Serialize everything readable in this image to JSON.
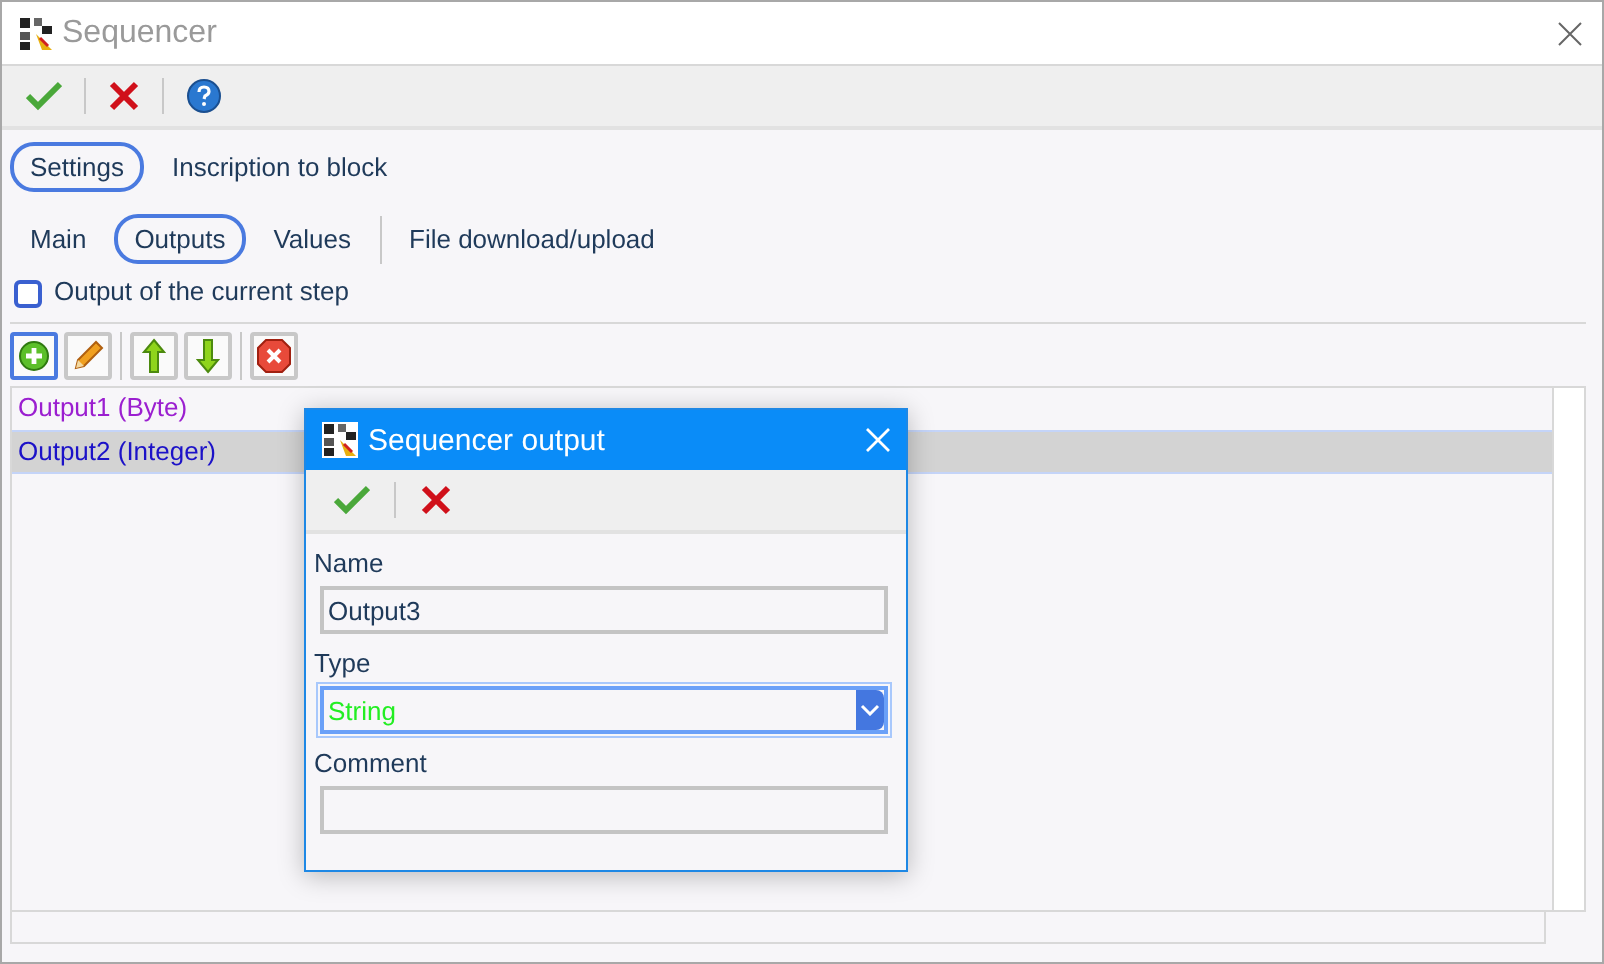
{
  "window": {
    "title": "Sequencer"
  },
  "toolbar": [
    {
      "kind": "ok"
    },
    {
      "kind": "cancel"
    },
    {
      "kind": "help"
    }
  ],
  "tabs": [
    {
      "label": "Settings",
      "selected": true
    },
    {
      "label": "Inscription to block",
      "selected": false
    }
  ],
  "subtabs": [
    {
      "label": "Main",
      "selected": false
    },
    {
      "label": "Outputs",
      "selected": true
    },
    {
      "label": "Values",
      "selected": false
    },
    {
      "label": "File download/upload",
      "selected": false,
      "separated": true
    }
  ],
  "checkbox": {
    "label": "Output of the current step",
    "checked": false
  },
  "list_toolbar": [
    {
      "kind": "add",
      "focused": true
    },
    {
      "kind": "edit",
      "focused": false
    },
    {
      "kind": "up",
      "focused": false
    },
    {
      "kind": "down",
      "focused": false
    },
    {
      "kind": "delete",
      "focused": false
    }
  ],
  "list": {
    "items": [
      {
        "label": "Output1 (Byte)",
        "color": "#9b1fd0",
        "selected": false
      },
      {
        "label": "Output2 (Integer)",
        "color": "#1c12c8",
        "selected": true
      }
    ]
  },
  "dialog": {
    "title": "Sequencer output",
    "toolbar": [
      {
        "kind": "ok"
      },
      {
        "kind": "cancel"
      }
    ],
    "fields": [
      {
        "label": "Name",
        "kind": "text",
        "value": "Output3",
        "focused": false
      },
      {
        "label": "Type",
        "kind": "select",
        "value": "String",
        "color": "#22ee22",
        "focused": true
      },
      {
        "label": "Comment",
        "kind": "text",
        "focused": false
      }
    ]
  }
}
